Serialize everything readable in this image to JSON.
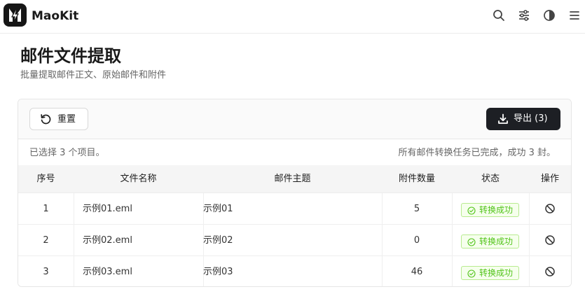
{
  "app": {
    "name": "MaoKit"
  },
  "header_icons": [
    "search-icon",
    "sliders-icon",
    "contrast-icon",
    "menu-icon"
  ],
  "page": {
    "title": "邮件文件提取",
    "subtitle": "批量提取邮件正文、原始邮件和附件"
  },
  "toolbar": {
    "reset_label": "重置",
    "export_label": "导出 (3)"
  },
  "status_bar": {
    "selection": "已选择 3 个项目。",
    "task_status": "所有邮件转换任务已完成，成功 3 封。"
  },
  "table": {
    "headers": {
      "index": "序号",
      "filename": "文件名称",
      "subject": "邮件主题",
      "attachments": "附件数量",
      "status": "状态",
      "actions": "操作"
    },
    "rows": [
      {
        "index": "1",
        "filename": "示例01.eml",
        "subject": "示例01",
        "attachments": "5",
        "status": "转换成功"
      },
      {
        "index": "2",
        "filename": "示例02.eml",
        "subject": "示例02",
        "attachments": "0",
        "status": "转换成功"
      },
      {
        "index": "3",
        "filename": "示例03.eml",
        "subject": "示例03",
        "attachments": "46",
        "status": "转换成功"
      }
    ]
  },
  "colors": {
    "success_text": "#52c41a",
    "success_border": "#b7eb8f",
    "success_bg": "#f6ffed",
    "primary_button": "#1d1f24"
  }
}
